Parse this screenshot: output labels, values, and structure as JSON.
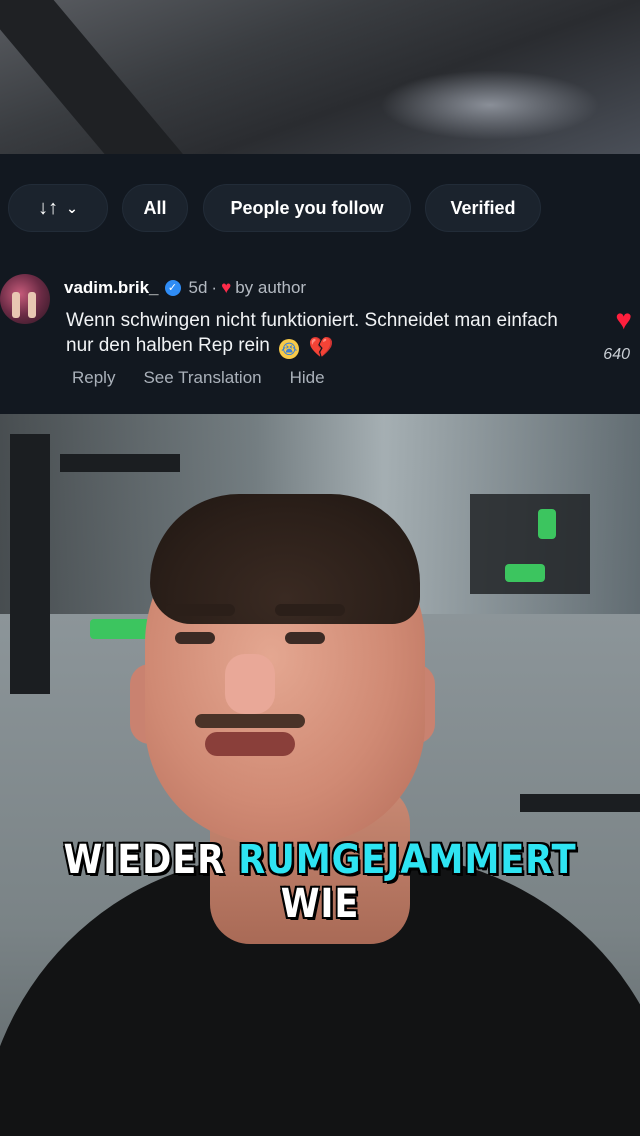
{
  "filters": {
    "sort_icon": "sort-arrows-icon",
    "chevron_icon": "chevron-down-icon",
    "all_label": "All",
    "people_follow_label": "People you follow",
    "verified_label": "Verified"
  },
  "comment": {
    "username": "vadim.brik_",
    "verified_icon": "verified-badge-icon",
    "time": "5d",
    "separator": "·",
    "liked_by": "by author",
    "text": "Wenn schwingen nicht funktioniert. Schneidet man einfach nur den halben Rep rein",
    "emojis": [
      "loudly-crying-face",
      "broken-heart"
    ],
    "like_count": "640",
    "actions": {
      "reply": "Reply",
      "see_translation": "See Translation",
      "hide": "Hide"
    }
  },
  "video": {
    "caption_word1": "WIEDER",
    "caption_highlight": "RUMGEJAMMERT",
    "caption_word2": "WIE",
    "caption_highlight_color": "#2ee4f2"
  },
  "colors": {
    "panel_bg": "#121820",
    "like_red": "#ff1f3d",
    "verified_blue": "#2f8cf5"
  }
}
